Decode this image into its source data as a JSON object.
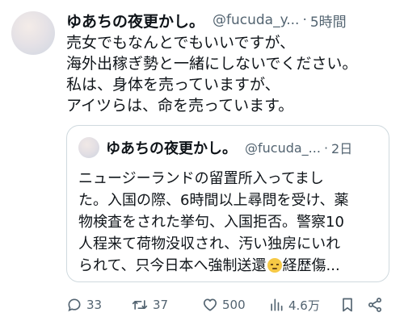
{
  "tweet": {
    "name": "ゆあちの夜更かし。",
    "handle": "@fucuda_y...",
    "time": "5時間",
    "lines": [
      "売女でもなんとでもいいですが、",
      "海外出稼ぎ勢と一緒にしないでください。",
      "私は、身体を売っていますが、",
      "アイツらは、命を売っています。"
    ]
  },
  "quote": {
    "name": "ゆあちの夜更かし。",
    "handle": "@fucuda_...",
    "time": "2日",
    "lines": [
      "ニュージーランドの留置所入ってまし",
      "た。入国の際、6時間以上尋問を受け、薬",
      "物検査をされた挙句、入国拒否。警察10",
      "人程来て荷物没収され、汚い独房にいれ"
    ],
    "last_line_before_emoji": "られて、只今日本へ強制送還",
    "last_line_after_emoji": "経歴傷..."
  },
  "actions": {
    "replies": "33",
    "retweets": "37",
    "likes": "500",
    "views": "4.6万"
  },
  "icons": {
    "reply": "speech-bubble-icon",
    "retweet": "retweet-icon",
    "like": "heart-icon",
    "views": "bar-chart-icon",
    "bookmark": "bookmark-icon",
    "share": "share-icon"
  }
}
